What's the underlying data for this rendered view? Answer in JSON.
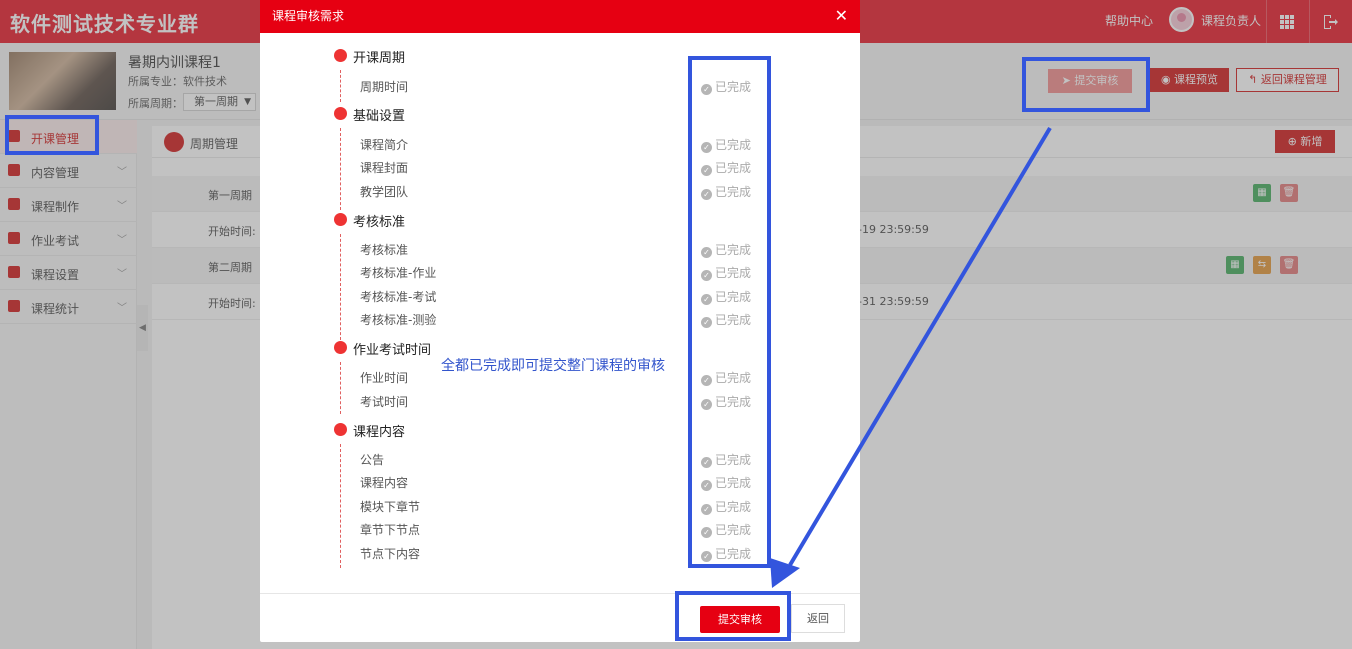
{
  "header": {
    "brand": "软件测试技术专业群",
    "help": "帮助中心",
    "user": "课程负责人",
    "grid_icon": "grid-icon",
    "logout_icon": "logout-icon"
  },
  "course": {
    "title": "暑期内训课程1",
    "major": "所属专业：软件技术",
    "period_label": "所属周期：",
    "period_value": "第一周期"
  },
  "top_actions": {
    "submit": "提交审核",
    "preview": "课程预览",
    "back": "返回课程管理"
  },
  "sidebar": {
    "items": [
      {
        "label": "开课管理"
      },
      {
        "label": "内容管理"
      },
      {
        "label": "课程制作"
      },
      {
        "label": "作业考试"
      },
      {
        "label": "课程设置"
      },
      {
        "label": "课程统计"
      }
    ]
  },
  "content": {
    "title": "周期管理",
    "add": "新增",
    "rows": [
      {
        "label": "第一周期",
        "time": ""
      },
      {
        "label": "开始时间:",
        "time": "-19 23:59:59"
      },
      {
        "label": "第二周期",
        "time": ""
      },
      {
        "label": "开始时间:",
        "time": "-31 23:59:59"
      }
    ]
  },
  "modal": {
    "title": "课程审核需求",
    "status_text": "已完成",
    "groups": [
      {
        "title": "开课周期",
        "items": [
          "周期时间"
        ]
      },
      {
        "title": "基础设置",
        "items": [
          "课程简介",
          "课程封面",
          "教学团队"
        ]
      },
      {
        "title": "考核标准",
        "items": [
          "考核标准",
          "考核标准-作业",
          "考核标准-考试",
          "考核标准-测验"
        ]
      },
      {
        "title": "作业考试时间",
        "items": [
          "作业时间",
          "考试时间"
        ]
      },
      {
        "title": "课程内容",
        "items": [
          "公告",
          "课程内容",
          "模块下章节",
          "章节下节点",
          "节点下内容"
        ]
      }
    ],
    "annotation": "全都已完成即可提交整门课程的审核",
    "submit": "提交审核",
    "return": "返回"
  },
  "colors": {
    "brand_red": "#e60012",
    "annotation_blue": "#3355dd"
  }
}
